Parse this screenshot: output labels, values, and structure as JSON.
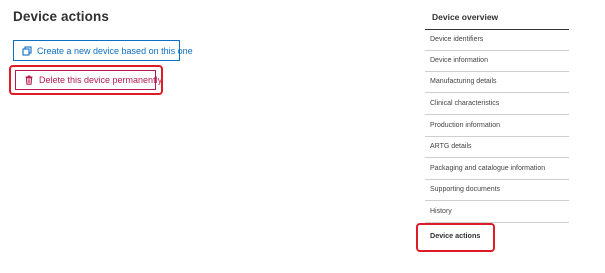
{
  "main": {
    "title": "Device actions",
    "buttons": {
      "create_label": "Create a new device based on this one",
      "delete_label": "Delete this device permanently"
    }
  },
  "sidebar": {
    "title": "Device overview",
    "items": [
      {
        "label": "Device identifiers"
      },
      {
        "label": "Device information"
      },
      {
        "label": "Manufacturing details"
      },
      {
        "label": "Clinical characteristics"
      },
      {
        "label": "Production information"
      },
      {
        "label": "ARTG details"
      },
      {
        "label": "Packaging and catalogue information"
      },
      {
        "label": "Supporting documents"
      },
      {
        "label": "History"
      },
      {
        "label": "Device actions",
        "active": true
      }
    ]
  },
  "colors": {
    "primary_blue": "#0e70c2",
    "danger_red": "#b51c4d",
    "highlight_red": "#de1b26"
  },
  "icons": {
    "create": "copy-icon",
    "delete": "trash-icon"
  }
}
